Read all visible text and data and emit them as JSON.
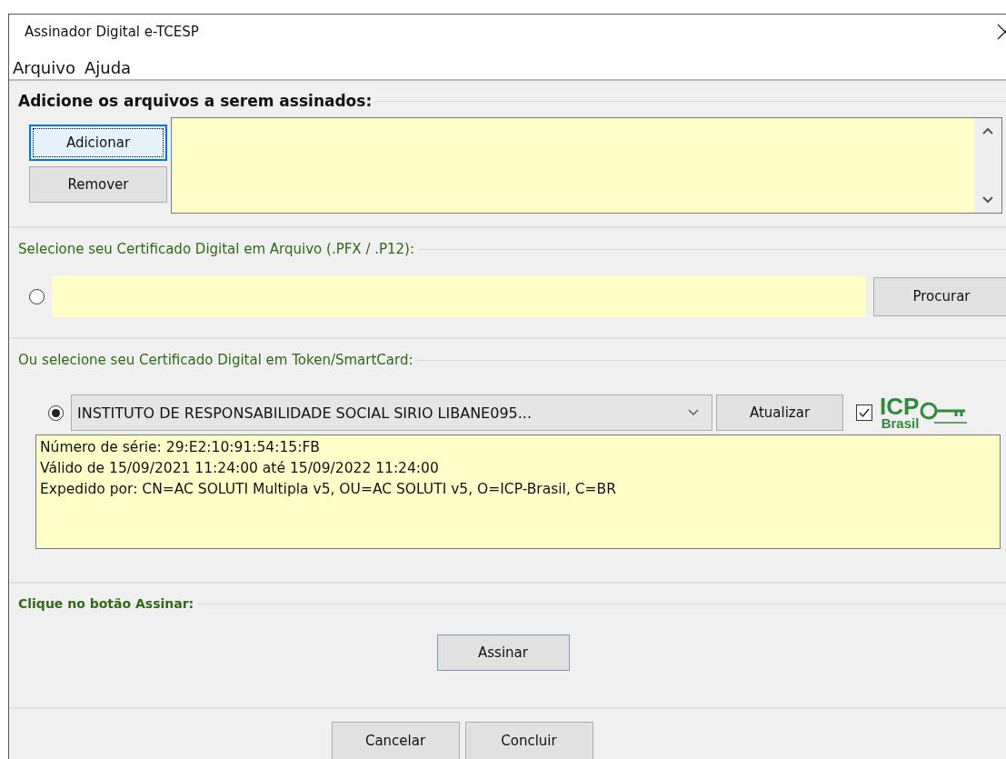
{
  "window": {
    "title": "Assinador Digital e-TCESP"
  },
  "menu": [
    {
      "label": "Arquivo"
    },
    {
      "label": "Ajuda"
    }
  ],
  "files_section": {
    "heading": "Adicione os arquivos a serem assinados:",
    "buttons": [
      {
        "label": "Adicionar",
        "focused": true
      },
      {
        "label": "Remover",
        "focused": false
      }
    ]
  },
  "file_certificate": {
    "heading": "Selecione seu Certificado Digital em Arquivo (.PFX / .P12):",
    "selected": false,
    "button": "Procurar"
  },
  "token_certificate": {
    "heading": "Ou selecione seu Certificado Digital em Token/SmartCard:",
    "selected": true,
    "certificate": "INSTITUTO DE RESPONSABILIDADE SOCIAL SIRIO LIBANE095...",
    "button": "Atualizar",
    "checked": true,
    "logo": {
      "top": "ICP",
      "bottom": "Brasil"
    },
    "details": [
      "Número de série: 29:E2:10:91:54:15:FB",
      "Válido de 15/09/2021 11:24:00 até 15/09/2022 11:24:00",
      "Expedido por: CN=AC SOLUTI Multipla v5, OU=AC SOLUTI v5, O=ICP-Brasil, C=BR"
    ]
  },
  "sign_section": {
    "heading": "Clique no botão Assinar:",
    "button": "Assinar"
  },
  "footer_buttons": [
    "Cancelar",
    "Concluir"
  ]
}
